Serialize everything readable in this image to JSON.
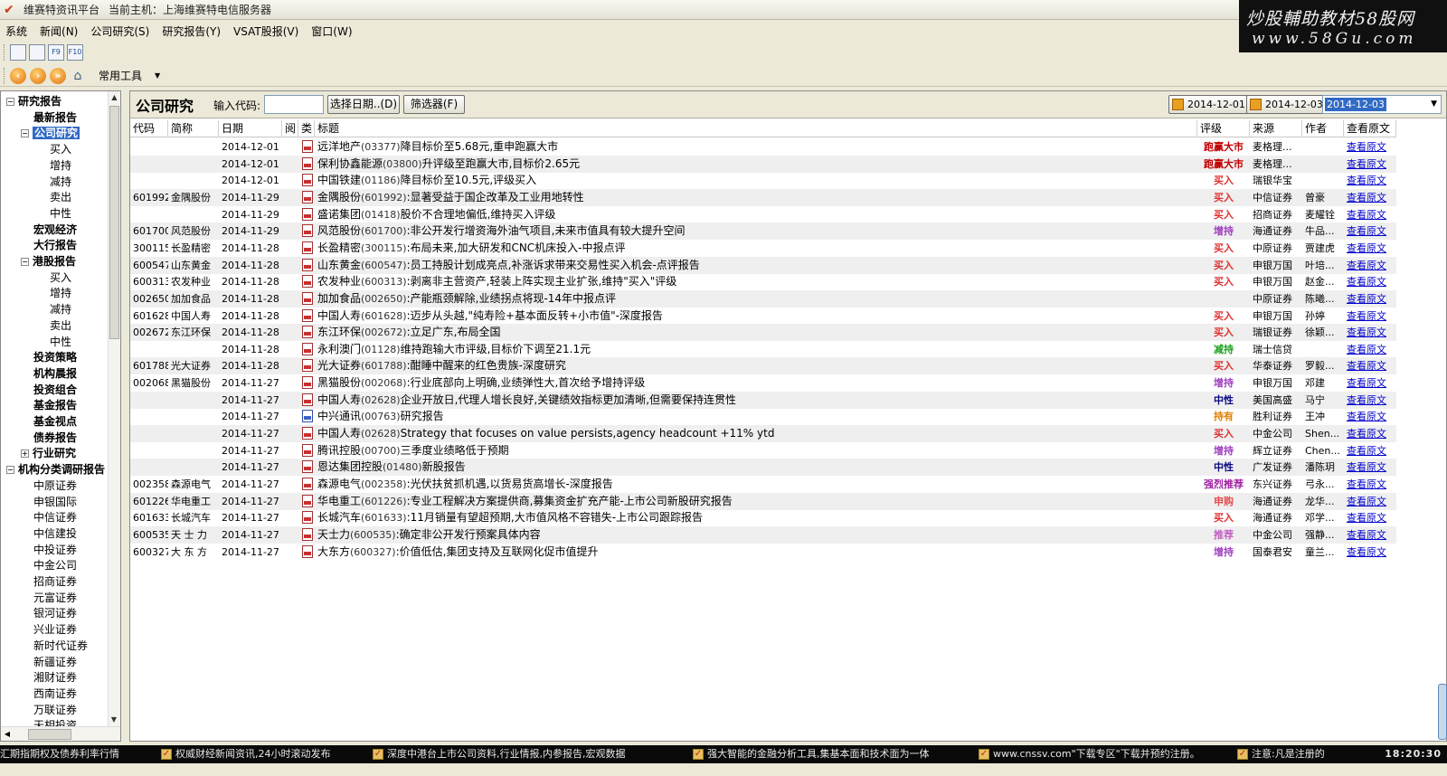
{
  "window": {
    "title": "维赛特资讯平台",
    "host": "当前主机：上海维赛特电信服务器"
  },
  "banner": {
    "line1": "炒股輔助教材58股网",
    "line2": "www.58Gu.com"
  },
  "menu": [
    "系统",
    "新闻(N)",
    "公司研究(S)",
    "研究报告(Y)",
    "VSAT股报(V)",
    "窗口(W)"
  ],
  "toolbar": {
    "icons": [
      "chart-line-icon",
      "chart-bar-icon",
      "f9-icon",
      "f10-icon"
    ],
    "icon_labels": [
      "",
      "",
      "F9",
      "F10"
    ],
    "tools_label": "常用工具"
  },
  "sidebar": {
    "items": [
      {
        "label": "研究报告",
        "level": 0,
        "expander": "−",
        "bold": true
      },
      {
        "label": "最新报告",
        "level": 1,
        "bold": true
      },
      {
        "label": "公司研究",
        "level": 1,
        "expander": "−",
        "bold": true,
        "selected": true
      },
      {
        "label": "买入",
        "level": 2
      },
      {
        "label": "增持",
        "level": 2
      },
      {
        "label": "减持",
        "level": 2
      },
      {
        "label": "卖出",
        "level": 2
      },
      {
        "label": "中性",
        "level": 2
      },
      {
        "label": "宏观经济",
        "level": 1,
        "bold": true
      },
      {
        "label": "大行报告",
        "level": 1,
        "bold": true
      },
      {
        "label": "港股报告",
        "level": 1,
        "expander": "−",
        "bold": true
      },
      {
        "label": "买入",
        "level": 2
      },
      {
        "label": "增持",
        "level": 2
      },
      {
        "label": "减持",
        "level": 2
      },
      {
        "label": "卖出",
        "level": 2
      },
      {
        "label": "中性",
        "level": 2
      },
      {
        "label": "投资策略",
        "level": 1,
        "bold": true
      },
      {
        "label": "机构晨报",
        "level": 1,
        "bold": true
      },
      {
        "label": "投资组合",
        "level": 1,
        "bold": true
      },
      {
        "label": "基金报告",
        "level": 1,
        "bold": true
      },
      {
        "label": "基金视点",
        "level": 1,
        "bold": true
      },
      {
        "label": "债券报告",
        "level": 1,
        "bold": true
      },
      {
        "label": "行业研究",
        "level": 1,
        "expander": "+",
        "bold": true
      },
      {
        "label": "机构分类调研报告",
        "level": 0,
        "expander": "−",
        "bold": true
      },
      {
        "label": "中原证券",
        "level": 1
      },
      {
        "label": "申银国际",
        "level": 1
      },
      {
        "label": "中信证券",
        "level": 1
      },
      {
        "label": "中信建投",
        "level": 1
      },
      {
        "label": "中投证券",
        "level": 1
      },
      {
        "label": "中金公司",
        "level": 1
      },
      {
        "label": "招商证券",
        "level": 1
      },
      {
        "label": "元富证券",
        "level": 1
      },
      {
        "label": "银河证券",
        "level": 1
      },
      {
        "label": "兴业证券",
        "level": 1
      },
      {
        "label": "新时代证券",
        "level": 1
      },
      {
        "label": "新疆证券",
        "level": 1
      },
      {
        "label": "湘财证券",
        "level": 1
      },
      {
        "label": "西南证券",
        "level": 1
      },
      {
        "label": "万联证券",
        "level": 1
      },
      {
        "label": "天相投资",
        "level": 1
      }
    ]
  },
  "main": {
    "heading": "公司研究",
    "code_label": "输入代码:",
    "code_value": "",
    "date_button": "选择日期..(D)",
    "filter_button": "筛选器(F)",
    "date_from": "2014-12-01",
    "date_to": "2014-12-03",
    "date_selected": "2014-12-03"
  },
  "table": {
    "columns": [
      "代码",
      "简称",
      "日期",
      "阅",
      "类",
      "标题",
      "评级",
      "来源",
      "作者",
      "查看原文"
    ],
    "rows": [
      {
        "code": "",
        "name": "",
        "date": "2014-12-01",
        "type": "pdf",
        "title": "远洋地产",
        "tcode": "(03377)",
        "ttext": "降目标价至5.68元,重申跑赢大市",
        "rating": "跑赢大市",
        "rcolor": "#c00000",
        "source": "麦格理...",
        "author": "",
        "link": "查看原文"
      },
      {
        "code": "",
        "name": "",
        "date": "2014-12-01",
        "type": "pdf",
        "title": "保利协鑫能源",
        "tcode": "(03800)",
        "ttext": "升评级至跑赢大市,目标价2.65元",
        "rating": "跑赢大市",
        "rcolor": "#c00000",
        "source": "麦格理...",
        "author": "",
        "link": "查看原文"
      },
      {
        "code": "",
        "name": "",
        "date": "2014-12-01",
        "type": "pdf",
        "title": "中国铁建",
        "tcode": "(01186)",
        "ttext": "降目标价至10.5元,评级买入",
        "rating": "买入",
        "rcolor": "#e03030",
        "source": "瑞银华宝",
        "author": "",
        "link": "查看原文"
      },
      {
        "code": "601992",
        "name": "金隅股份",
        "date": "2014-11-29",
        "type": "pdf",
        "title": "金隅股份",
        "tcode": "(601992)",
        "ttext": ":显著受益于国企改革及工业用地转性",
        "rating": "买入",
        "rcolor": "#e03030",
        "source": "中信证券",
        "author": "曾豪",
        "link": "查看原文"
      },
      {
        "code": "",
        "name": "",
        "date": "2014-11-29",
        "type": "pdf",
        "title": "盛诺集团",
        "tcode": "(01418)",
        "ttext": "股价不合理地偏低,维持买入评级",
        "rating": "买入",
        "rcolor": "#e03030",
        "source": "招商证券",
        "author": "麦耀铨",
        "link": "查看原文"
      },
      {
        "code": "601700",
        "name": "风范股份",
        "date": "2014-11-29",
        "type": "pdf",
        "title": "风范股份",
        "tcode": "(601700)",
        "ttext": ":非公开发行增资海外油气项目,未来市值具有较大提升空间",
        "rating": "增持",
        "rcolor": "#a040c0",
        "source": "海通证券",
        "author": "牛品...",
        "link": "查看原文"
      },
      {
        "code": "300115",
        "name": "长盈精密",
        "date": "2014-11-28",
        "type": "pdf",
        "title": "长盈精密",
        "tcode": "(300115)",
        "ttext": ":布局未来,加大研发和CNC机床投入-中报点评",
        "rating": "买入",
        "rcolor": "#e03030",
        "source": "中原证券",
        "author": "贾建虎",
        "link": "查看原文"
      },
      {
        "code": "600547",
        "name": "山东黄金",
        "date": "2014-11-28",
        "type": "pdf",
        "title": "山东黄金",
        "tcode": "(600547)",
        "ttext": ":员工持股计划成亮点,补涨诉求带来交易性买入机会-点评报告",
        "rating": "买入",
        "rcolor": "#e03030",
        "source": "申银万国",
        "author": "叶培...",
        "link": "查看原文"
      },
      {
        "code": "600313",
        "name": "农发种业",
        "date": "2014-11-28",
        "type": "pdf",
        "title": "农发种业",
        "tcode": "(600313)",
        "ttext": ":剥离非主营资产,轻装上阵实现主业扩张,维持\"买入\"评级",
        "rating": "买入",
        "rcolor": "#e03030",
        "source": "申银万国",
        "author": "赵金...",
        "link": "查看原文"
      },
      {
        "code": "002650",
        "name": "加加食品",
        "date": "2014-11-28",
        "type": "pdf",
        "title": "加加食品",
        "tcode": "(002650)",
        "ttext": ":产能瓶颈解除,业绩拐点将现-14年中报点评",
        "rating": "",
        "rcolor": "#000000",
        "source": "中原证券",
        "author": "陈曦...",
        "link": "查看原文"
      },
      {
        "code": "601628",
        "name": "中国人寿",
        "date": "2014-11-28",
        "type": "pdf",
        "title": "中国人寿",
        "tcode": "(601628)",
        "ttext": ":迈步从头越,\"纯寿险+基本面反转+小市值\"-深度报告",
        "rating": "买入",
        "rcolor": "#e03030",
        "source": "申银万国",
        "author": "孙婷",
        "link": "查看原文"
      },
      {
        "code": "002672",
        "name": "东江环保",
        "date": "2014-11-28",
        "type": "pdf",
        "title": "东江环保",
        "tcode": "(002672)",
        "ttext": ":立足广东,布局全国",
        "rating": "买入",
        "rcolor": "#e03030",
        "source": "瑞银证券",
        "author": "徐颖...",
        "link": "查看原文"
      },
      {
        "code": "",
        "name": "",
        "date": "2014-11-28",
        "type": "pdf",
        "title": "永利澳门",
        "tcode": "(01128)",
        "ttext": "维持跑输大市评级,目标价下调至21.1元",
        "rating": "减持",
        "rcolor": "#20a020",
        "source": "瑞士信贷",
        "author": "",
        "link": "查看原文"
      },
      {
        "code": "601788",
        "name": "光大证券",
        "date": "2014-11-28",
        "type": "pdf",
        "title": "光大证券",
        "tcode": "(601788)",
        "ttext": ":酣睡中醒来的红色贵族-深度研究",
        "rating": "买入",
        "rcolor": "#e03030",
        "source": "华泰证券",
        "author": "罗毅...",
        "link": "查看原文"
      },
      {
        "code": "002068",
        "name": "黑猫股份",
        "date": "2014-11-27",
        "type": "pdf",
        "title": "黑猫股份",
        "tcode": "(002068)",
        "ttext": ":行业底部向上明确,业绩弹性大,首次给予增持评级",
        "rating": "增持",
        "rcolor": "#a040c0",
        "source": "申银万国",
        "author": "邓建",
        "link": "查看原文"
      },
      {
        "code": "",
        "name": "",
        "date": "2014-11-27",
        "type": "pdf",
        "title": "中国人寿",
        "tcode": "(02628)",
        "ttext": "企业开放日,代理人增长良好,关键绩效指标更加清晰,但需要保持连贯性",
        "rating": "中性",
        "rcolor": "#0a0a80",
        "source": "美国高盛",
        "author": "马宁",
        "link": "查看原文"
      },
      {
        "code": "",
        "name": "",
        "date": "2014-11-27",
        "type": "word",
        "title": "中兴通讯",
        "tcode": "(00763)",
        "ttext": "研究报告",
        "rating": "持有",
        "rcolor": "#e08000",
        "source": "胜利证券",
        "author": "王冲",
        "link": "查看原文"
      },
      {
        "code": "",
        "name": "",
        "date": "2014-11-27",
        "type": "pdf",
        "title": "中国人寿",
        "tcode": "(02628)",
        "ttext": "Strategy that focuses on value persists,agency headcount +11% ytd",
        "rating": "买入",
        "rcolor": "#e03030",
        "source": "中金公司",
        "author": "Shen...",
        "link": "查看原文"
      },
      {
        "code": "",
        "name": "",
        "date": "2014-11-27",
        "type": "pdf",
        "title": "腾讯控股",
        "tcode": "(00700)",
        "ttext": "三季度业绩略低于预期",
        "rating": "增持",
        "rcolor": "#a040c0",
        "source": "辉立证券",
        "author": "Chen...",
        "link": "查看原文"
      },
      {
        "code": "",
        "name": "",
        "date": "2014-11-27",
        "type": "pdf",
        "title": "恩达集团控股",
        "tcode": "(01480)",
        "ttext": "新股报告",
        "rating": "中性",
        "rcolor": "#0a0a80",
        "source": "广发证券",
        "author": "潘陈玥",
        "link": "查看原文"
      },
      {
        "code": "002358",
        "name": "森源电气",
        "date": "2014-11-27",
        "type": "pdf",
        "title": "森源电气",
        "tcode": "(002358)",
        "ttext": ":光伏扶贫抓机遇,以货易货高增长-深度报告",
        "rating": "强烈推荐",
        "rcolor": "#a020a0",
        "source": "东兴证券",
        "author": "弓永...",
        "link": "查看原文"
      },
      {
        "code": "601226",
        "name": "华电重工",
        "date": "2014-11-27",
        "type": "pdf",
        "title": "华电重工",
        "tcode": "(601226)",
        "ttext": ":专业工程解决方案提供商,募集资金扩充产能-上市公司新股研究报告",
        "rating": "申购",
        "rcolor": "#e05050",
        "source": "海通证券",
        "author": "龙华...",
        "link": "查看原文"
      },
      {
        "code": "601633",
        "name": "长城汽车",
        "date": "2014-11-27",
        "type": "pdf",
        "title": "长城汽车",
        "tcode": "(601633)",
        "ttext": ":11月销量有望超预期,大市值风格不容错失-上市公司跟踪报告",
        "rating": "买入",
        "rcolor": "#e03030",
        "source": "海通证券",
        "author": "邓学...",
        "link": "查看原文"
      },
      {
        "code": "600535",
        "name": "天 士 力",
        "date": "2014-11-27",
        "type": "pdf",
        "title": "天士力",
        "tcode": "(600535)",
        "ttext": ":确定非公开发行预案具体内容",
        "rating": "推荐",
        "rcolor": "#c060c0",
        "source": "中金公司",
        "author": "强静...",
        "link": "查看原文"
      },
      {
        "code": "600327",
        "name": "大 东 方",
        "date": "2014-11-27",
        "type": "pdf",
        "title": "大东方",
        "tcode": "(600327)",
        "ttext": ":价值低估,集团支持及互联网化促市值提升",
        "rating": "增持",
        "rcolor": "#a040c0",
        "source": "国泰君安",
        "author": "童兰...",
        "link": "查看原文"
      }
    ]
  },
  "status": {
    "tickers": [
      "汇期指期权及债券利率行情",
      "权威财经新闻资讯,24小时滚动发布",
      "深度中港台上市公司资料,行业情报,内参报告,宏观数据",
      "强大智能的金融分析工具,集基本面和技术面为一体",
      "www.cnssv.com\"下载专区\"下载并预约注册。",
      "注意:凡是注册的"
    ],
    "clock": "18:20:30"
  }
}
